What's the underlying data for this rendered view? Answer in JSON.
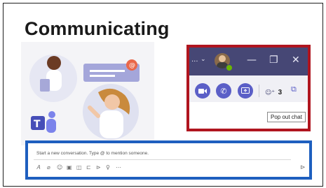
{
  "slide": {
    "title": "Communicating"
  },
  "teams_window": {
    "title_dots": "...",
    "people_count": "3",
    "tooltip": "Pop out chat"
  },
  "compose": {
    "placeholder": "Start a new conversation. Type @ to mention someone."
  },
  "colors": {
    "teams_purple": "#464775",
    "accent_red_frame": "#b0151f",
    "accent_blue_frame": "#1e5fbf",
    "call_button": "#5b5fc7"
  }
}
